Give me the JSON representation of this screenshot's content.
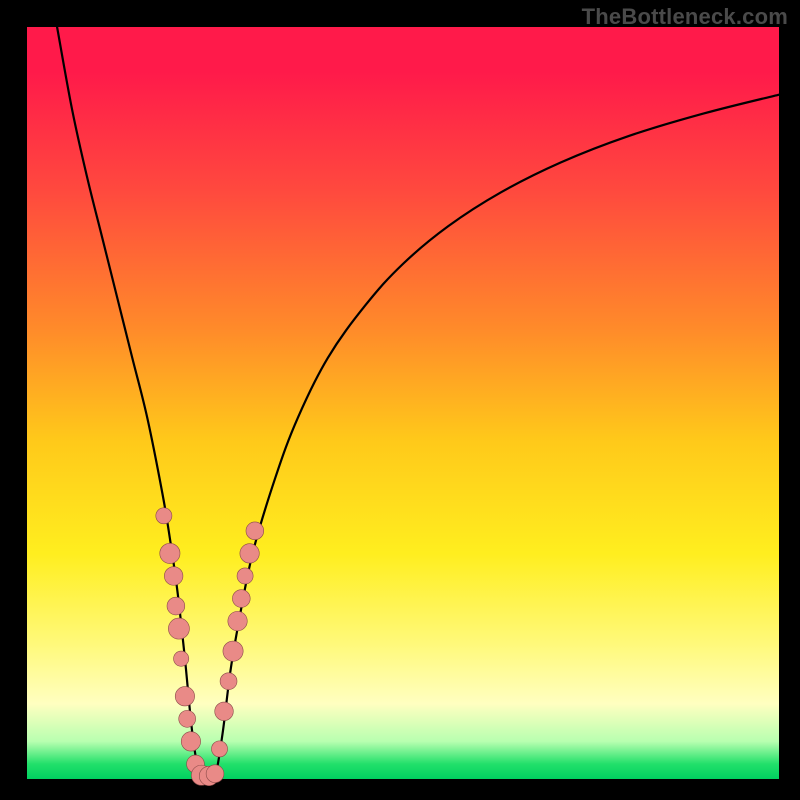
{
  "watermark": "TheBottleneck.com",
  "colors": {
    "frame": "#000000",
    "curve": "#000000",
    "dot_fill": "#e98a87",
    "dot_stroke": "#8a4a48",
    "gradient_top": "#ff1a4a",
    "gradient_bottom": "#00d060"
  },
  "chart_data": {
    "type": "line",
    "title": "",
    "xlabel": "",
    "ylabel": "",
    "xlim": [
      0,
      100
    ],
    "ylim": [
      0,
      100
    ],
    "legend": false,
    "grid": false,
    "series": [
      {
        "name": "bottleneck-curve",
        "x": [
          4,
          6,
          8,
          10,
          12,
          14,
          16,
          18,
          19,
          20,
          21,
          22,
          23,
          24,
          25,
          26,
          27,
          28,
          30,
          33,
          36,
          40,
          45,
          50,
          56,
          63,
          71,
          80,
          90,
          100
        ],
        "values": [
          100,
          89,
          80,
          72,
          64,
          56,
          48,
          38,
          32,
          25,
          16,
          6,
          0.3,
          0.2,
          0.3,
          6,
          14,
          20,
          30,
          40,
          48,
          56,
          63,
          68.5,
          73.5,
          78,
          82,
          85.5,
          88.5,
          91
        ]
      }
    ],
    "scatter": [
      {
        "name": "data-points",
        "points": [
          {
            "x": 18.2,
            "y": 35,
            "r": 1.1
          },
          {
            "x": 19.0,
            "y": 30,
            "r": 1.6
          },
          {
            "x": 19.5,
            "y": 27,
            "r": 1.4
          },
          {
            "x": 19.8,
            "y": 23,
            "r": 1.3
          },
          {
            "x": 20.2,
            "y": 20,
            "r": 1.7
          },
          {
            "x": 20.5,
            "y": 16,
            "r": 1.0
          },
          {
            "x": 21.0,
            "y": 11,
            "r": 1.5
          },
          {
            "x": 21.3,
            "y": 8,
            "r": 1.2
          },
          {
            "x": 21.8,
            "y": 5,
            "r": 1.5
          },
          {
            "x": 22.4,
            "y": 2,
            "r": 1.3
          },
          {
            "x": 23.2,
            "y": 0.5,
            "r": 1.6
          },
          {
            "x": 24.2,
            "y": 0.4,
            "r": 1.5
          },
          {
            "x": 25.0,
            "y": 0.7,
            "r": 1.3
          },
          {
            "x": 25.6,
            "y": 4,
            "r": 1.1
          },
          {
            "x": 26.2,
            "y": 9,
            "r": 1.4
          },
          {
            "x": 26.8,
            "y": 13,
            "r": 1.2
          },
          {
            "x": 27.4,
            "y": 17,
            "r": 1.6
          },
          {
            "x": 28.0,
            "y": 21,
            "r": 1.5
          },
          {
            "x": 28.5,
            "y": 24,
            "r": 1.3
          },
          {
            "x": 29.0,
            "y": 27,
            "r": 1.1
          },
          {
            "x": 29.6,
            "y": 30,
            "r": 1.5
          },
          {
            "x": 30.3,
            "y": 33,
            "r": 1.3
          }
        ]
      }
    ]
  }
}
